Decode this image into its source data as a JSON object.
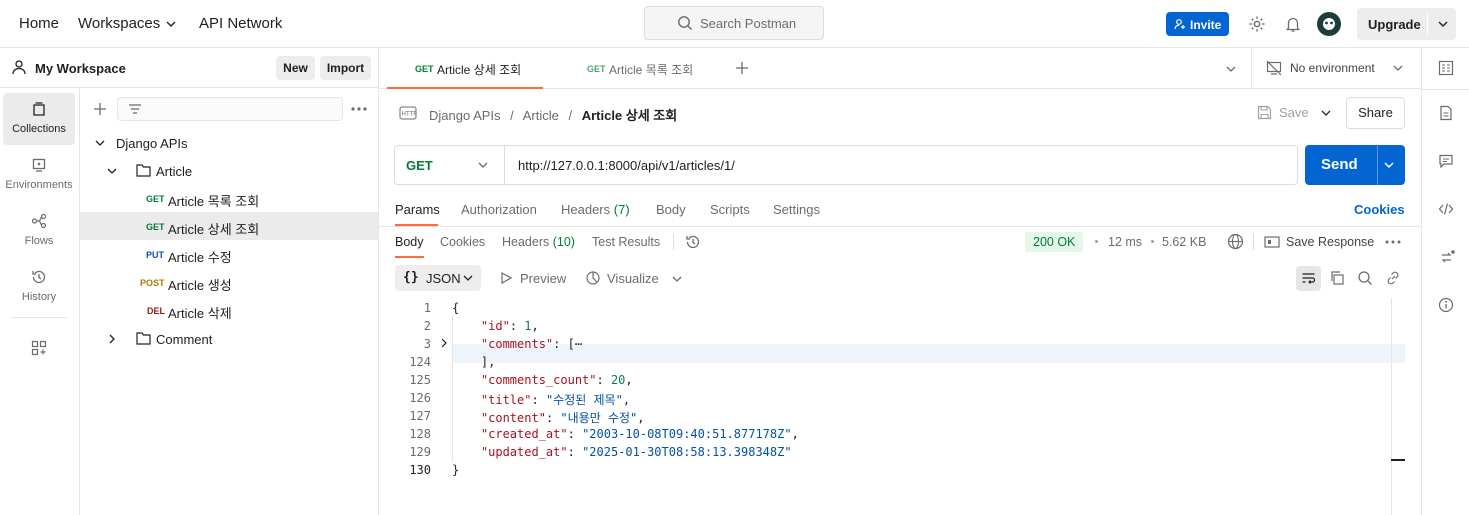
{
  "topbar": {
    "home": "Home",
    "workspaces": "Workspaces",
    "api_network": "API Network",
    "search_placeholder": "Search Postman",
    "invite": "Invite",
    "upgrade": "Upgrade"
  },
  "sidebar": {
    "workspace_name": "My Workspace",
    "new_label": "New",
    "import_label": "Import",
    "rail": [
      {
        "label": "Collections",
        "icon": "collections-icon"
      },
      {
        "label": "Environments",
        "icon": "environments-icon"
      },
      {
        "label": "Flows",
        "icon": "flows-icon"
      },
      {
        "label": "History",
        "icon": "history-icon"
      }
    ],
    "tree": {
      "collection": "Django APIs",
      "folder": "Article",
      "requests": [
        {
          "method": "GET",
          "name": "Article 목록 조회"
        },
        {
          "method": "GET",
          "name": "Article 상세 조회"
        },
        {
          "method": "PUT",
          "name": "Article 수정"
        },
        {
          "method": "POST",
          "name": "Article 생성"
        },
        {
          "method": "DEL",
          "name": "Article 삭제"
        }
      ],
      "folder2": "Comment"
    }
  },
  "tabs": [
    {
      "method": "GET",
      "name": "Article 상세 조회"
    },
    {
      "method": "GET",
      "name": "Article 목록 조회"
    }
  ],
  "environment": "No environment",
  "breadcrumb": {
    "root": "Django APIs",
    "sep1": "/",
    "folder": "Article",
    "sep2": "/",
    "current": "Article 상세 조회"
  },
  "request": {
    "save": "Save",
    "share": "Share",
    "method": "GET",
    "url": "http://127.0.0.1:8000/api/v1/articles/1/",
    "send": "Send",
    "tabs": {
      "params": "Params",
      "authorization": "Authorization",
      "headers": "Headers",
      "headers_count": "(7)",
      "body": "Body",
      "scripts": "Scripts",
      "settings": "Settings"
    },
    "cookies": "Cookies"
  },
  "response": {
    "tabs": {
      "body": "Body",
      "cookies": "Cookies",
      "headers": "Headers",
      "headers_count": "(10)",
      "test_results": "Test Results"
    },
    "status": "200 OK",
    "time": "12 ms",
    "size": "5.62 KB",
    "save_response": "Save Response",
    "format": "JSON",
    "preview": "Preview",
    "visualize": "Visualize",
    "lines": [
      {
        "n": "1",
        "text": "{"
      },
      {
        "n": "2",
        "key": "\"id\"",
        "sep": ": ",
        "num": "1",
        "end": ","
      },
      {
        "n": "3",
        "key": "\"comments\"",
        "sep": ": ",
        "end": "[⋯"
      },
      {
        "n": "124",
        "text": "    ],"
      },
      {
        "n": "125",
        "key": "\"comments_count\"",
        "sep": ": ",
        "num": "20",
        "end": ","
      },
      {
        "n": "126",
        "key": "\"title\"",
        "sep": ": ",
        "str": "\"수정된 제목\"",
        "end": ","
      },
      {
        "n": "127",
        "key": "\"content\"",
        "sep": ": ",
        "str": "\"내용만 수정\"",
        "end": ","
      },
      {
        "n": "128",
        "key": "\"created_at\"",
        "sep": ": ",
        "str": "\"2003-10-08T09:40:51.877178Z\"",
        "end": ","
      },
      {
        "n": "129",
        "key": "\"updated_at\"",
        "sep": ": ",
        "str": "\"2025-01-30T08:58:13.398348Z\"",
        "end": ""
      },
      {
        "n": "130",
        "text": "}"
      }
    ]
  }
}
